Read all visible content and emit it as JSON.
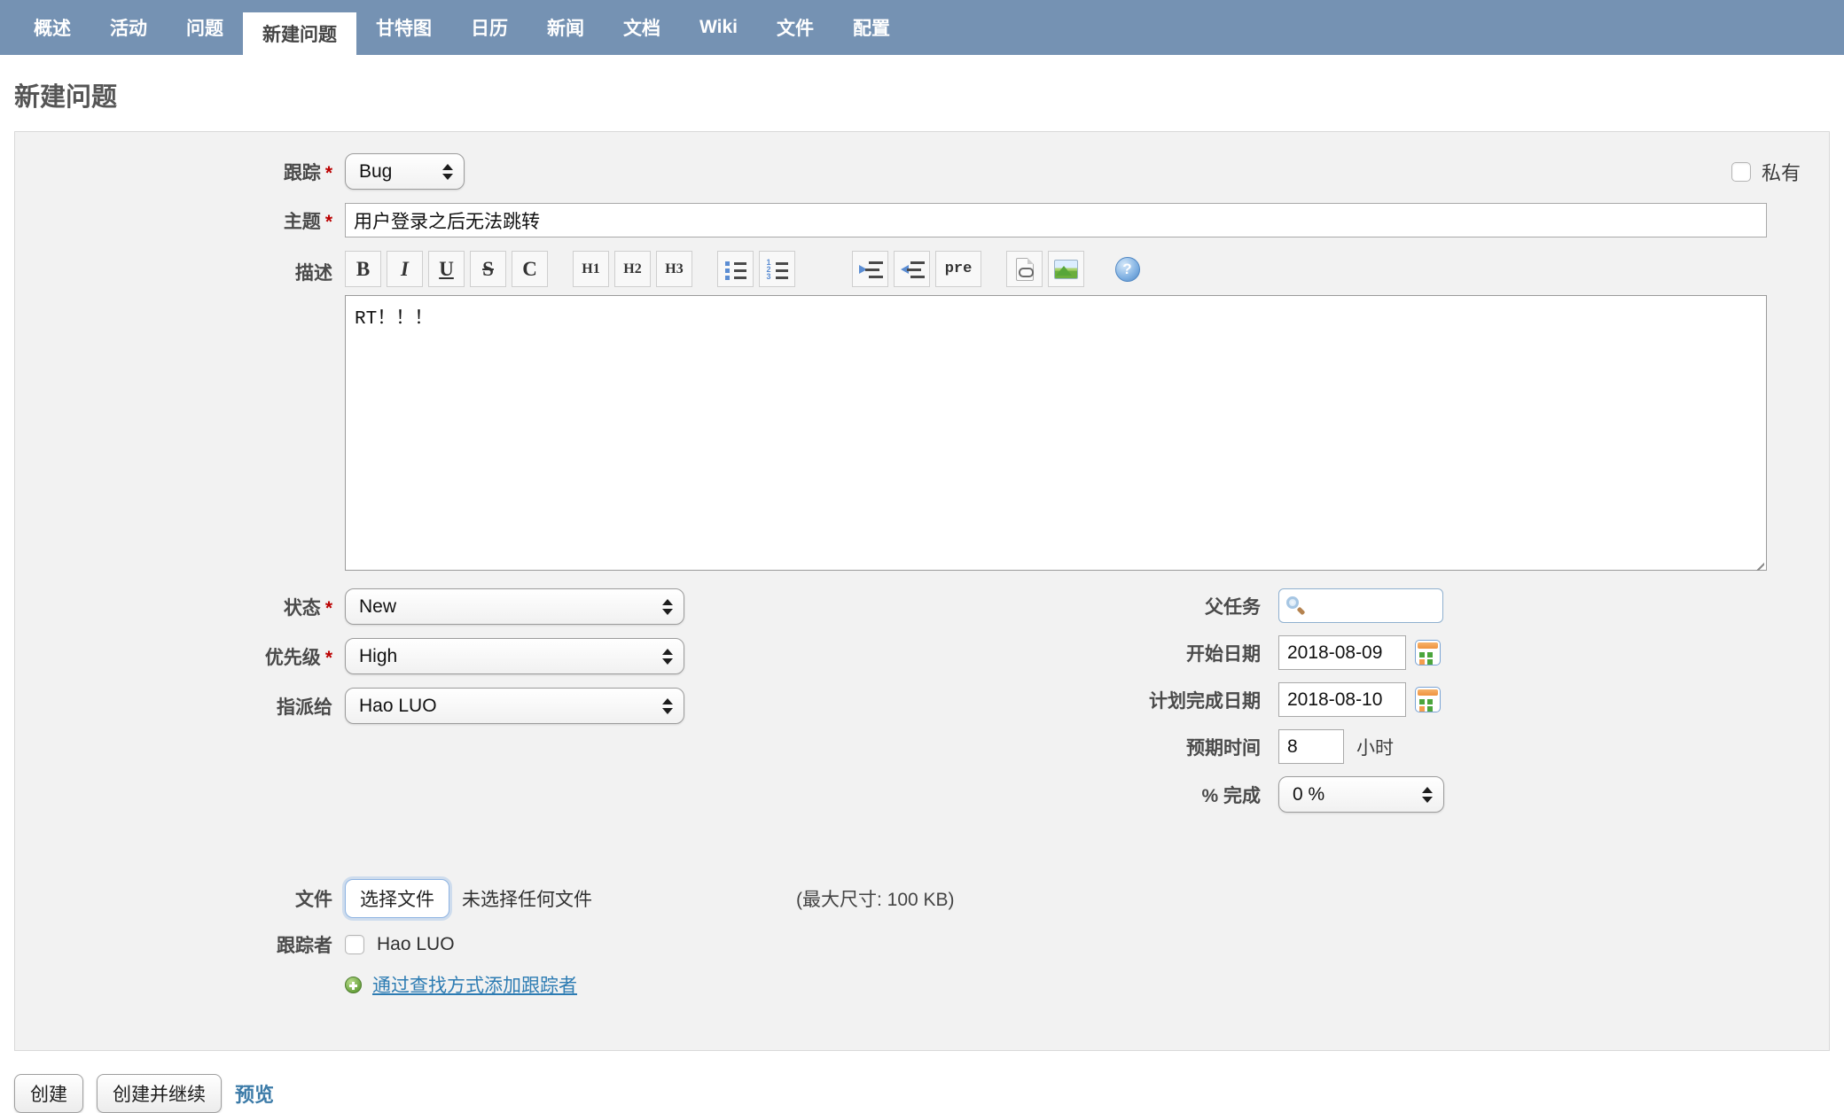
{
  "nav": {
    "items": [
      "概述",
      "活动",
      "问题",
      "新建问题",
      "甘特图",
      "日历",
      "新闻",
      "文档",
      "Wiki",
      "文件",
      "配置"
    ],
    "active": "新建问题"
  },
  "page": {
    "title": "新建问题"
  },
  "form": {
    "tracker": {
      "label": "跟踪",
      "required": "*",
      "value": "Bug"
    },
    "private": {
      "label": "私有",
      "checked": false
    },
    "subject": {
      "label": "主题",
      "required": "*",
      "value": "用户登录之后无法跳转"
    },
    "description": {
      "label": "描述",
      "value": "RT！！！",
      "toolbar": [
        {
          "name": "bold",
          "glyph": "B"
        },
        {
          "name": "italic",
          "glyph": "I"
        },
        {
          "name": "underline",
          "glyph": "U"
        },
        {
          "name": "strikethrough",
          "glyph": "S"
        },
        {
          "name": "code",
          "glyph": "C"
        },
        {
          "name": "heading-1",
          "glyph": "H1"
        },
        {
          "name": "heading-2",
          "glyph": "H2"
        },
        {
          "name": "heading-3",
          "glyph": "H3"
        },
        {
          "name": "unordered-list",
          "glyph": ""
        },
        {
          "name": "ordered-list",
          "glyph": ""
        },
        {
          "name": "indent-increase",
          "glyph": ""
        },
        {
          "name": "indent-decrease",
          "glyph": ""
        },
        {
          "name": "preformatted",
          "glyph": "pre"
        },
        {
          "name": "link",
          "glyph": ""
        },
        {
          "name": "image",
          "glyph": ""
        },
        {
          "name": "help",
          "glyph": ""
        }
      ]
    },
    "status": {
      "label": "状态",
      "required": "*",
      "value": "New"
    },
    "priority": {
      "label": "优先级",
      "required": "*",
      "value": "High"
    },
    "assignee": {
      "label": "指派给",
      "value": "Hao LUO"
    },
    "parent_task": {
      "label": "父任务",
      "value": ""
    },
    "start_date": {
      "label": "开始日期",
      "value": "2018-08-09"
    },
    "due_date": {
      "label": "计划完成日期",
      "value": "2018-08-10"
    },
    "estimated_time": {
      "label": "预期时间",
      "value": "8",
      "unit": "小时"
    },
    "done_ratio": {
      "label": "% 完成",
      "value": "0 %"
    },
    "files": {
      "label": "文件",
      "button": "选择文件",
      "no_file_text": "未选择任何文件",
      "max_size_text": "(最大尺寸: 100 KB)"
    },
    "watchers": {
      "label": "跟踪者",
      "name": "Hao LUO",
      "checked": false,
      "add_link": "通过查找方式添加跟踪者"
    }
  },
  "actions": {
    "create": "创建",
    "create_and_continue": "创建并继续",
    "preview": "预览"
  },
  "colors": {
    "nav_background": "#7592b3",
    "link": "#2d7cb3",
    "required_mark": "#bb0000",
    "box_background": "#f2f2f2"
  }
}
